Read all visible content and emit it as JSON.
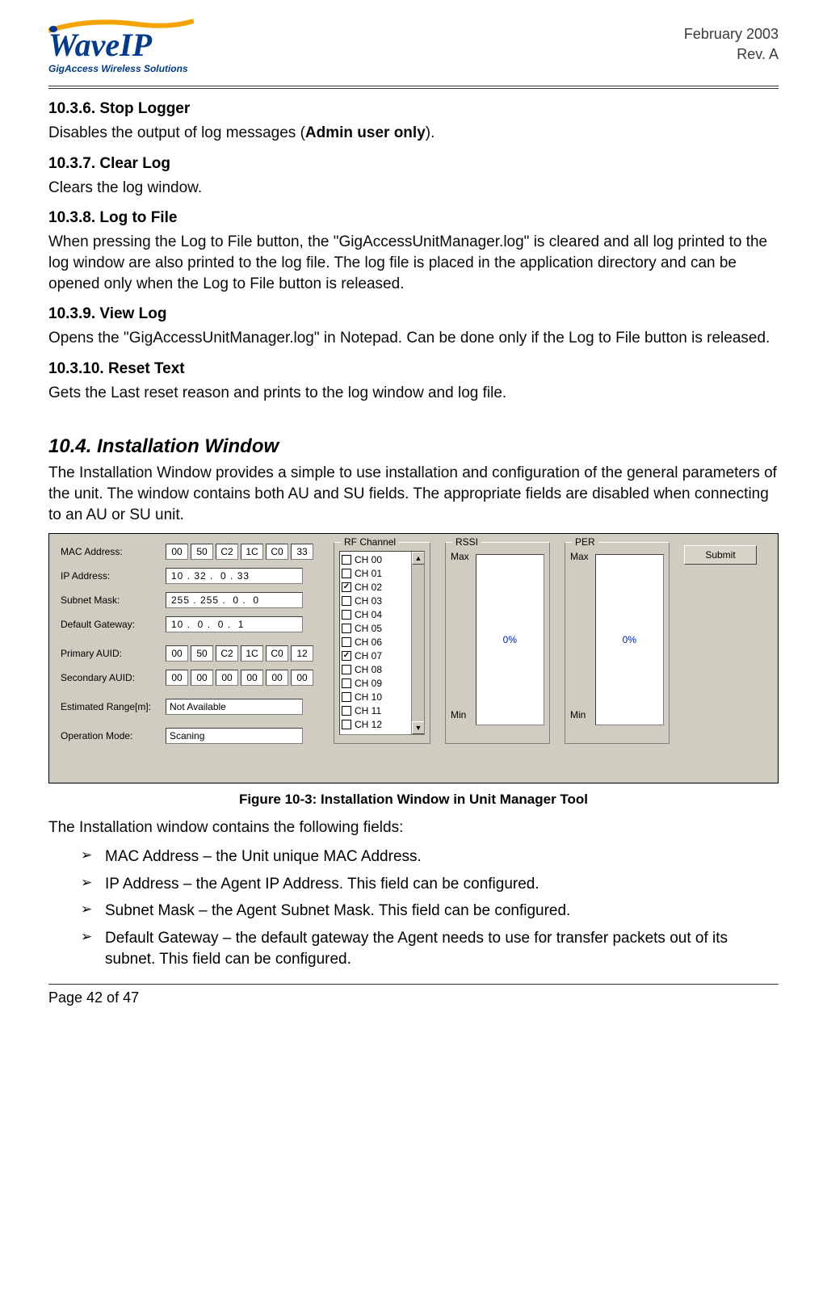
{
  "header": {
    "logo_main": "WaveIP",
    "logo_sub": "GigAccess Wireless Solutions",
    "date": "February 2003",
    "rev": "Rev. A"
  },
  "sections": {
    "s1_title": "10.3.6. Stop Logger",
    "s1_body_a": "Disables the output of log messages (",
    "s1_body_b": "Admin user only",
    "s1_body_c": ").",
    "s2_title": "10.3.7. Clear Log",
    "s2_body": "Clears the log window.",
    "s3_title": "10.3.8. Log to File",
    "s3_body": "When pressing the Log to File button, the \"GigAccessUnitManager.log\" is cleared and all log printed to the log window are also printed to the log file. The log file is placed in the application directory and can be opened only when the Log to File button is released.",
    "s4_title": "10.3.9. View Log",
    "s4_body": "Opens the \"GigAccessUnitManager.log\" in Notepad. Can be done only if the Log to File button is released.",
    "s5_title": "10.3.10. Reset Text",
    "s5_body": "Gets the Last reset reason and prints to the log window and log file.",
    "major_title": "10.4. Installation Window",
    "major_body": "The Installation Window provides a simple to use installation and configuration of the general parameters of the unit. The window contains both AU and SU fields. The appropriate fields are disabled when connecting to an AU or SU unit."
  },
  "figure": {
    "labels": {
      "mac": "MAC Address:",
      "ip": "IP Address:",
      "subnet": "Subnet Mask:",
      "gw": "Default Gateway:",
      "pauid": "Primary AUID:",
      "sauid": "Secondary AUID:",
      "range": "Estimated Range[m]:",
      "mode": "Operation Mode:"
    },
    "mac": [
      "00",
      "50",
      "C2",
      "1C",
      "C0",
      "33"
    ],
    "ip": "10 . 32 .  0 . 33",
    "subnet": "255 . 255 .  0 .  0",
    "gw": "10 .  0 .  0 .  1",
    "pauid": [
      "00",
      "50",
      "C2",
      "1C",
      "C0",
      "12"
    ],
    "sauid": [
      "00",
      "00",
      "00",
      "00",
      "00",
      "00"
    ],
    "range": "Not Available",
    "mode": "Scaning",
    "rf_title": "RF Channel",
    "rf_channels": [
      {
        "label": "CH 00",
        "checked": false
      },
      {
        "label": "CH 01",
        "checked": false
      },
      {
        "label": "CH 02",
        "checked": true
      },
      {
        "label": "CH 03",
        "checked": false
      },
      {
        "label": "CH 04",
        "checked": false
      },
      {
        "label": "CH 05",
        "checked": false
      },
      {
        "label": "CH 06",
        "checked": false
      },
      {
        "label": "CH 07",
        "checked": true
      },
      {
        "label": "CH 08",
        "checked": false
      },
      {
        "label": "CH 09",
        "checked": false
      },
      {
        "label": "CH 10",
        "checked": false
      },
      {
        "label": "CH 11",
        "checked": false
      },
      {
        "label": "CH 12",
        "checked": false
      }
    ],
    "rssi_title": "RSSI",
    "per_title": "PER",
    "max": "Max",
    "min": "Min",
    "pct": "0%",
    "submit": "Submit"
  },
  "caption": "Figure 10-3: Installation Window in Unit Manager Tool",
  "post": {
    "intro": "The Installation window contains the following fields:",
    "bullets": [
      "MAC Address – the Unit unique MAC Address.",
      "IP Address – the Agent IP Address. This field can be configured.",
      "Subnet Mask – the Agent Subnet Mask. This field can be configured.",
      "Default Gateway – the default gateway the Agent needs to use for transfer packets out of its subnet. This field can be configured."
    ]
  },
  "footer": "Page 42 of 47"
}
